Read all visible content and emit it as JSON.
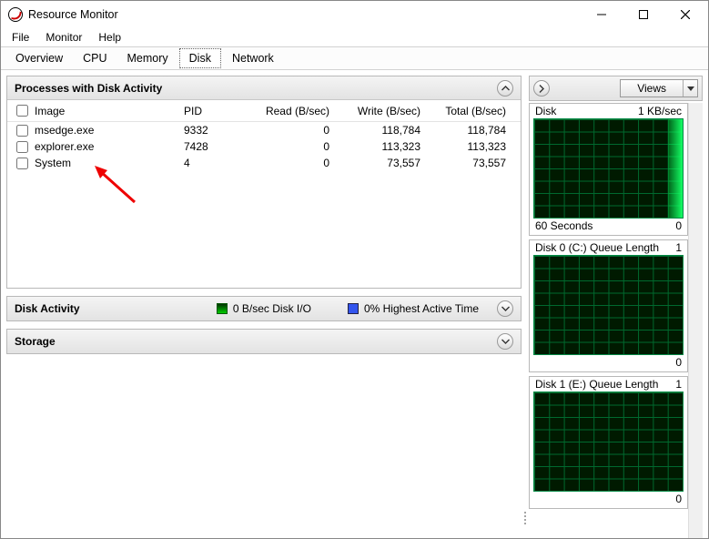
{
  "window": {
    "title": "Resource Monitor"
  },
  "menu": [
    "File",
    "Monitor",
    "Help"
  ],
  "tabs": {
    "items": [
      "Overview",
      "CPU",
      "Memory",
      "Disk",
      "Network"
    ],
    "active": 3
  },
  "panels": {
    "processes": {
      "title": "Processes with Disk Activity",
      "columns": {
        "image": "Image",
        "pid": "PID",
        "read": "Read (B/sec)",
        "write": "Write (B/sec)",
        "total": "Total (B/sec)"
      },
      "rows": [
        {
          "image": "msedge.exe",
          "pid": "9332",
          "read": "0",
          "write": "118,784",
          "total": "118,784"
        },
        {
          "image": "explorer.exe",
          "pid": "7428",
          "read": "0",
          "write": "113,323",
          "total": "113,323"
        },
        {
          "image": "System",
          "pid": "4",
          "read": "0",
          "write": "73,557",
          "total": "73,557"
        }
      ]
    },
    "disk_activity": {
      "title": "Disk Activity",
      "io_label": "0 B/sec Disk I/O",
      "active_label": "0% Highest Active Time"
    },
    "storage": {
      "title": "Storage"
    }
  },
  "sidebar": {
    "views_label": "Views",
    "graphs": [
      {
        "title_left": "Disk",
        "title_right": "1 KB/sec",
        "foot_left": "60 Seconds",
        "foot_right": "0",
        "activity": "bright"
      },
      {
        "title_left": "Disk 0 (C:) Queue Length",
        "title_right": "1",
        "foot_left": "",
        "foot_right": "0",
        "activity": "none"
      },
      {
        "title_left": "Disk 1 (E:) Queue Length",
        "title_right": "1",
        "foot_left": "",
        "foot_right": "0",
        "activity": "none"
      }
    ]
  }
}
